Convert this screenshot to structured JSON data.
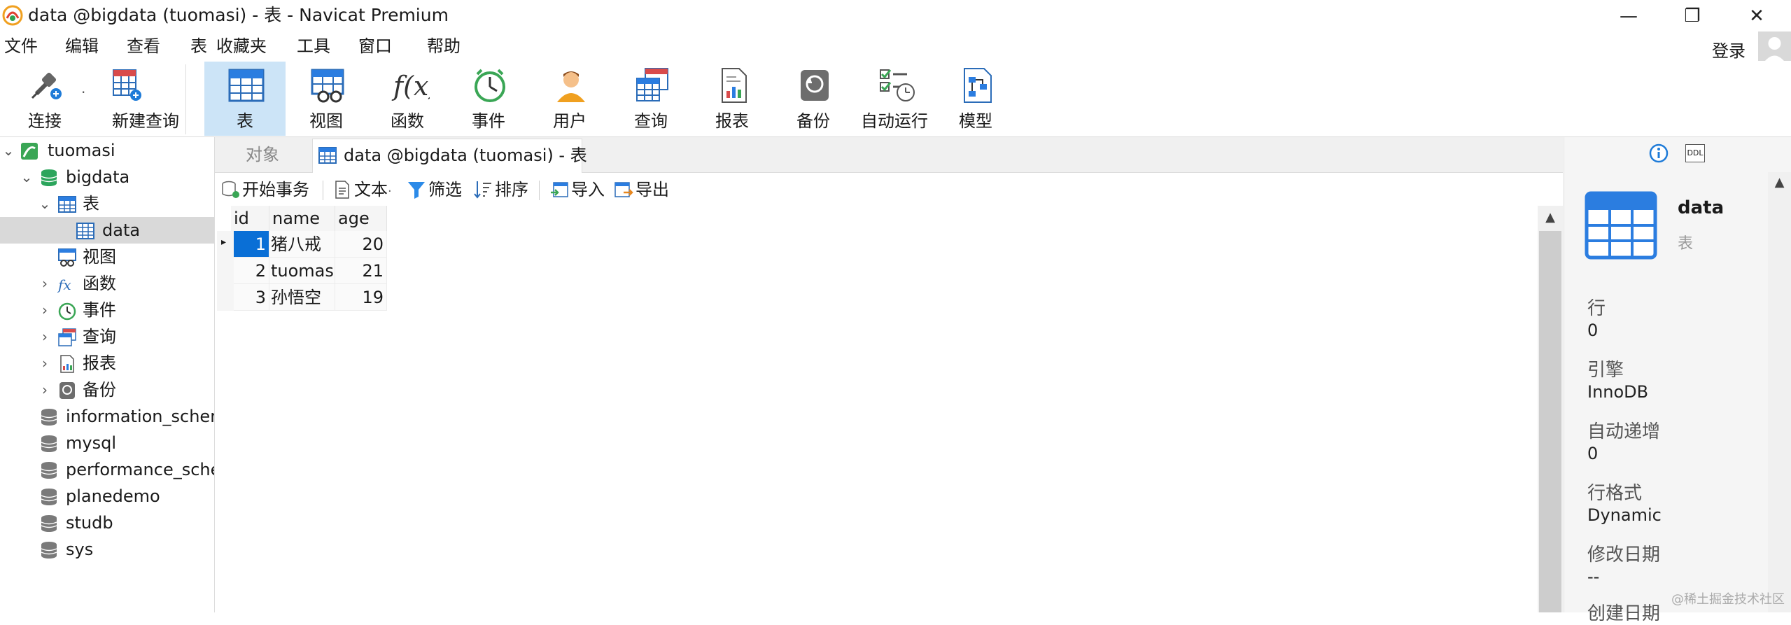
{
  "window": {
    "title": "data @bigdata (tuomasi) - 表 - Navicat Premium",
    "minimize": "—",
    "restore": "❐",
    "close": "✕"
  },
  "menu": [
    "文件",
    "编辑",
    "查看",
    "表",
    "收藏夹",
    "工具",
    "窗口",
    "帮助"
  ],
  "account": {
    "login": "登录"
  },
  "toolbar": {
    "connect": "连接",
    "new_query": "新建查询",
    "table": "表",
    "view": "视图",
    "function": "函数",
    "event": "事件",
    "user": "用户",
    "query": "查询",
    "report": "报表",
    "backup": "备份",
    "automation": "自动运行",
    "model": "模型"
  },
  "tree": {
    "connection": "tuomasi",
    "database": "bigdata",
    "tables": "表",
    "table_data": "data",
    "views": "视图",
    "functions": "函数",
    "events": "事件",
    "queries": "查询",
    "reports": "报表",
    "backups": "备份",
    "other_dbs": [
      "information_schema",
      "mysql",
      "performance_schema",
      "planedemo",
      "studb",
      "sys"
    ]
  },
  "tabs": {
    "objects": "对象",
    "active": "data @bigdata (tuomasi) - 表"
  },
  "grid_toolbar": {
    "begin_transaction": "开始事务",
    "text": "文本",
    "text_arrow": "·",
    "filter": "筛选",
    "sort": "排序",
    "import": "导入",
    "export": "导出"
  },
  "grid": {
    "columns": [
      "id",
      "name",
      "age"
    ],
    "rows": [
      {
        "id": "1",
        "name": "猪八戒",
        "age": "20"
      },
      {
        "id": "2",
        "name": "tuomasi",
        "age": "21"
      },
      {
        "id": "3",
        "name": "孙悟空",
        "age": "19"
      }
    ]
  },
  "info": {
    "name": "data",
    "type": "表",
    "props": [
      {
        "label": "行",
        "value": "0"
      },
      {
        "label": "引擎",
        "value": "InnoDB"
      },
      {
        "label": "自动递增",
        "value": "0"
      },
      {
        "label": "行格式",
        "value": "Dynamic"
      },
      {
        "label": "修改日期",
        "value": "--"
      },
      {
        "label": "创建日期",
        "value": ""
      }
    ],
    "ddl_icon_text": "DDL"
  },
  "watermark": "@稀土掘金技术社区",
  "colors": {
    "accent": "#0a6fd6",
    "selected_toolbar": "#cce4f7",
    "db_green": "#2ca55c"
  }
}
